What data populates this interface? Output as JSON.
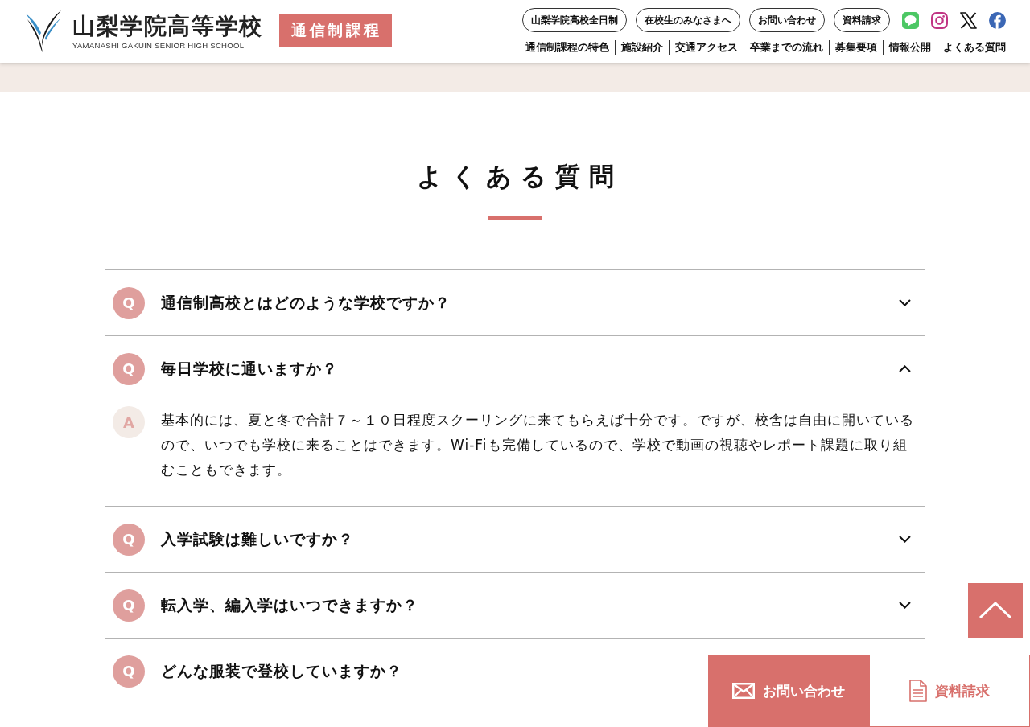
{
  "header": {
    "school_name": "山梨学院高等学校",
    "school_name_english": "YAMANASHI GAKUIN SENIOR HIGH SCHOOL",
    "course_label": "通信制課程",
    "top_links": [
      "山梨学院高校全日制",
      "在校生のみなさまへ",
      "お問い合わせ",
      "資料請求"
    ],
    "nav": [
      "通信制課程の特色",
      "施設紹介",
      "交通アクセス",
      "卒業までの流れ",
      "募集要項",
      "情報公開",
      "よくある質問"
    ]
  },
  "page_title": "よくある質問",
  "faq": [
    {
      "question_mark": "Q",
      "question": "通信制高校とはどのような学校ですか？",
      "expanded": false
    },
    {
      "question_mark": "Q",
      "question": "毎日学校に通いますか？",
      "expanded": true,
      "answer_mark": "A",
      "answer": "基本的には、夏と冬で合計７～１０日程度スクーリングに来てもらえば十分です。ですが、校舎は自由に開いているので、いつでも学校に来ることはできます。Wi-Fiも完備しているので、学校で動画の視聴やレポート課題に取り組むこともできます。"
    },
    {
      "question_mark": "Q",
      "question": "入学試験は難しいですか？",
      "expanded": false
    },
    {
      "question_mark": "Q",
      "question": "転入学、編入学はいつできますか？",
      "expanded": false
    },
    {
      "question_mark": "Q",
      "question": "どんな服装で登校していますか？",
      "expanded": false
    }
  ],
  "floating_actions": {
    "contact": "お問い合わせ",
    "request": "資料請求"
  }
}
